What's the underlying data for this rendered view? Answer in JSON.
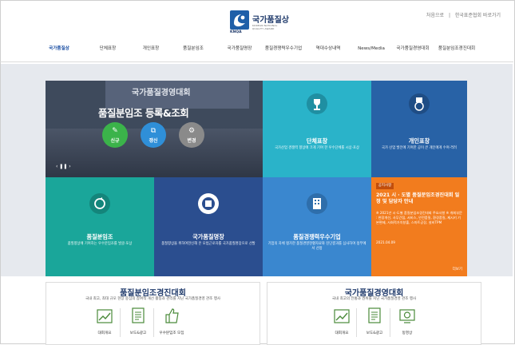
{
  "top_links": [
    "처음으로",
    "|",
    "한국표준협회 바로가기"
  ],
  "logo": {
    "name": "국가품질상",
    "sub_line1": "KOREAN NATIONAL",
    "sub_line2": "QUALITY AWARD",
    "abbr": "KNQA"
  },
  "gnb": [
    {
      "label": "국가품질상",
      "active": true
    },
    {
      "label": "단체표창",
      "active": false
    },
    {
      "label": "개인표창",
      "active": false
    },
    {
      "label": "품질분임조",
      "active": false
    },
    {
      "label": "국가품질명장",
      "active": false
    },
    {
      "label": "품질경쟁력우수기업",
      "active": false
    },
    {
      "label": "역대수상내역",
      "active": false
    },
    {
      "label": "News/Media",
      "active": false
    },
    {
      "label": "국가품질경영대회",
      "active": false
    },
    {
      "label": "품질분임조경진대회",
      "active": false
    }
  ],
  "hero": {
    "stage_text": "국가품질경영대회",
    "title": "품질분임조 등록&조회",
    "buttons": [
      {
        "icon": "✎",
        "label": "신규",
        "color": "#3bb34a"
      },
      {
        "icon": "⧉",
        "label": "갱신",
        "color": "#2f8fd8"
      },
      {
        "icon": "⚙",
        "label": "변경",
        "color": "#8a8a8a"
      }
    ],
    "controls": "‹  ❚❚  ›"
  },
  "tiles": [
    {
      "title": "단체표창",
      "desc": "국가산업 경쟁력 향상에 크게 기여 한 우수단체를 시상·포상",
      "color": "#2ab3c9",
      "icon": "trophy-icon"
    },
    {
      "title": "개인표창",
      "desc": "국가 산업 발전에 기여한 공이 큰 개인에게 수여·격려",
      "color": "#2862a6",
      "icon": "medal-icon"
    },
    {
      "title": "품질분임조",
      "desc": "품질향상에 기여하는 우수분임조를 발굴·포상",
      "color": "#1aa69a",
      "icon": "cycle-icon"
    },
    {
      "title": "국가품질명장",
      "desc": "품질향상을 위하여헌신해 온 모범근로자를 국가품질명장으로 선발",
      "color": "#2b4e8f",
      "icon": "seal-icon"
    },
    {
      "title": "품질경쟁력우수기업",
      "desc": "기업의 자체 평가한 품질경영현황자료와 진단결과를 심사하여 정부에서 선정",
      "color": "#3a87cf",
      "icon": "building-icon"
    }
  ],
  "news": {
    "badge": "공지사항",
    "title": "2021 시 · 도별 품질분임조경진대회 일정 및 담당자 안내",
    "text": "※ 2021년 시·도별 품질분임조경진대회 주요사항 ※ 개최부문 : 현장개선, 사무간접, 서비스, 안전품질, 환경품질, 제시키 기본편제, 사회적가치창출, 스마트공장, 설비TPM",
    "date": "2021.04.09",
    "more": "더보기"
  },
  "panels": [
    {
      "title": "품질분임조경진대회",
      "desc": "국내 최고, 최대 규모 현장 중심의 참여적 개선 활동과 관리를 지닌 국가품질경영 관조 행사",
      "items": [
        {
          "label": "대회개요",
          "icon": "chart-up-icon"
        },
        {
          "label": "보도&광고",
          "icon": "document-icon"
        },
        {
          "label": "우수분임조 모집",
          "icon": "thumbs-up-icon"
        }
      ]
    },
    {
      "title": "국가품질경영대회",
      "desc": "국내 최고의 전통과 권위를 지닌 국가품질경영 관조 행사",
      "items": [
        {
          "label": "대회개요",
          "icon": "chart-up-icon"
        },
        {
          "label": "보도&광고",
          "icon": "document-icon"
        },
        {
          "label": "동영상",
          "icon": "video-icon"
        }
      ]
    }
  ]
}
